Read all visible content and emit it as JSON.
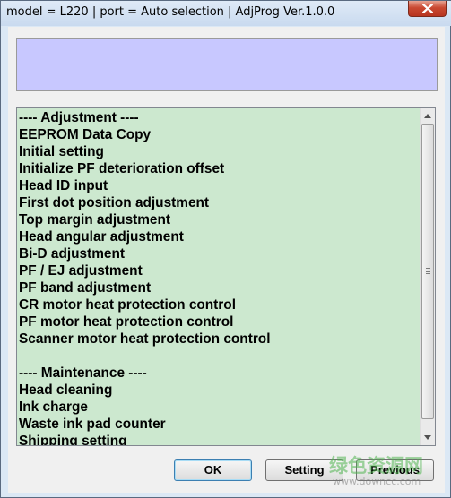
{
  "window": {
    "title": "model = L220 | port = Auto selection | AdjProg Ver.1.0.0"
  },
  "display_box": {
    "text": ""
  },
  "list": {
    "items": [
      "---- Adjustment ----",
      "EEPROM Data Copy",
      "Initial setting",
      "Initialize PF deterioration offset",
      "Head ID input",
      "First dot position adjustment",
      "Top margin adjustment",
      "Head angular adjustment",
      "Bi-D adjustment",
      "PF / EJ adjustment",
      "PF band adjustment",
      "CR motor heat protection control",
      "PF motor heat protection control",
      "Scanner motor heat protection control",
      "",
      "---- Maintenance ----",
      "Head cleaning",
      "Ink charge",
      "Waste ink pad counter",
      "Shipping setting"
    ],
    "background_color": "#cce8cf"
  },
  "buttons": {
    "ok": "OK",
    "setting": "Setting",
    "previous": "Previous"
  },
  "watermark": {
    "logo_text": "绿色资源网",
    "url": "www.downcc.com"
  },
  "colors": {
    "display_box": "#c8c8ff",
    "close_button": "#c94932"
  },
  "icons": {
    "close": "close-icon",
    "scroll_up": "arrow-up-icon",
    "scroll_down": "arrow-down-icon"
  }
}
